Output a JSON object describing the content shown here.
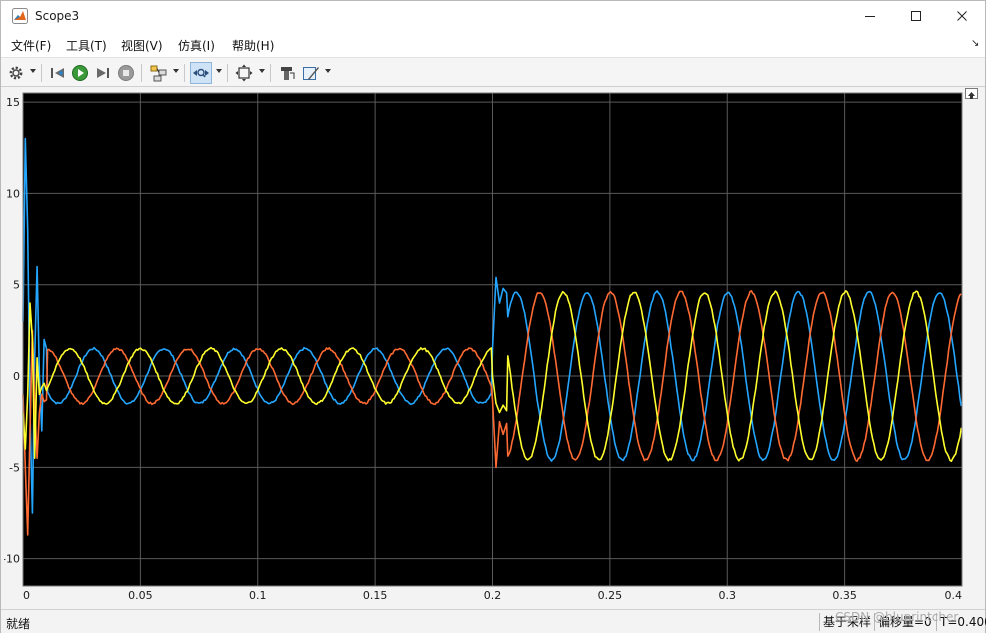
{
  "window": {
    "title": "Scope3"
  },
  "menu": [
    "文件(F)",
    "工具(T)",
    "视图(V)",
    "仿真(I)",
    "帮助(H)"
  ],
  "toolbar": {
    "icons": [
      "gear-icon",
      "step-back-icon",
      "run-icon",
      "step-forward-icon",
      "stop-icon",
      "signal-selector-icon",
      "zoom-time-icon",
      "fit-to-view-icon",
      "highlight-icon",
      "style-icon"
    ]
  },
  "status": {
    "text": "就绪",
    "sample_mode": "基于采样",
    "offset": "偏移量=0",
    "time": "T=0.400",
    "watermark": "CSDN @bluprintcher"
  },
  "colors": {
    "plot_bg": "#000000",
    "grid": "#5a5a5a",
    "axis_text": "#1b1b1b",
    "series_a": "#24a6ff",
    "series_b": "#ff6a33",
    "series_c": "#ffff2e"
  },
  "chart_data": {
    "type": "line",
    "title": "",
    "xlabel": "",
    "ylabel": "",
    "xlim": [
      0,
      0.4
    ],
    "ylim": [
      -11.5,
      15.5
    ],
    "xticks": [
      0,
      0.05,
      0.1,
      0.15,
      0.2,
      0.25,
      0.3,
      0.35,
      0.4
    ],
    "xtick_labels": [
      "0",
      "0.05",
      "0.1",
      "0.15",
      "0.2",
      "0.25",
      "0.3",
      "0.35",
      "0.4"
    ],
    "yticks": [
      -10,
      -5,
      0,
      5,
      10,
      15
    ],
    "ytick_labels": [
      "-10",
      "-5",
      "0",
      "5",
      "10",
      "15"
    ],
    "grid": true,
    "frequency_hz": 33.3,
    "series": [
      {
        "color": "#24a6ff",
        "amplitude_before": 1.5,
        "amplitude_after": 4.6,
        "phase_deg": 90,
        "startup_x": [
          0,
          0.001,
          0.002,
          0.003,
          0.004,
          0.005,
          0.006,
          0.007,
          0.008,
          0.009,
          0.01
        ],
        "startup_y": [
          3.0,
          13.0,
          8.0,
          -2.0,
          -7.5,
          1.0,
          6.0,
          0.0,
          -3.0,
          2.0,
          1.5
        ],
        "transient_x": [
          0.2,
          0.2015,
          0.203,
          0.2045,
          0.206
        ],
        "transient_y": [
          1.5,
          5.4,
          4.0,
          4.8,
          4.55
        ]
      },
      {
        "color": "#ff6a33",
        "amplitude_before": 1.5,
        "amplitude_after": 4.6,
        "phase_deg": -30,
        "startup_x": [
          0,
          0.001,
          0.002,
          0.003,
          0.004,
          0.005,
          0.006,
          0.007,
          0.008,
          0.009,
          0.01
        ],
        "startup_y": [
          -1.0,
          -5.0,
          -8.7,
          -3.0,
          2.5,
          -1.5,
          -4.5,
          -2.0,
          -1.0,
          -1.4,
          -1.3
        ],
        "transient_x": [
          0.2,
          0.2015,
          0.203,
          0.2045,
          0.206
        ],
        "transient_y": [
          -1.3,
          -5.0,
          -2.5,
          -3.2,
          -2.6
        ]
      },
      {
        "color": "#ffff2e",
        "amplitude_before": 1.5,
        "amplitude_after": 4.6,
        "phase_deg": -150,
        "startup_x": [
          0,
          0.001,
          0.002,
          0.003,
          0.004,
          0.005,
          0.006,
          0.007,
          0.008,
          0.009,
          0.01
        ],
        "startup_y": [
          -2.0,
          -4.0,
          -1.0,
          4.0,
          2.0,
          -4.5,
          1.0,
          -1.0,
          -0.6,
          -0.4,
          -0.8
        ],
        "transient_x": [
          0.2,
          0.2015,
          0.203,
          0.2045,
          0.206
        ],
        "transient_y": [
          0.0,
          -1.5,
          -2.0,
          -1.6,
          -1.9
        ]
      }
    ]
  }
}
